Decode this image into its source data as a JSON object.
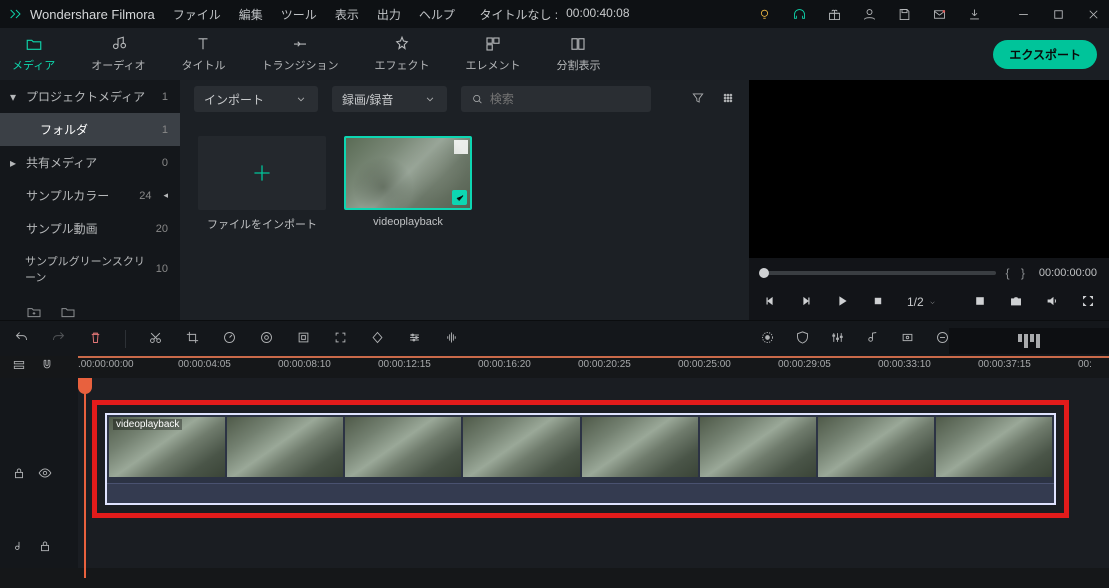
{
  "titlebar": {
    "brand": "Wondershare Filmora",
    "menu": [
      "ファイル",
      "編集",
      "ツール",
      "表示",
      "出力",
      "ヘルプ"
    ],
    "project_title": "タイトルなし :",
    "project_time": "00:00:40:08"
  },
  "tabs": [
    {
      "icon": "folder",
      "label": "メディア",
      "active": true
    },
    {
      "icon": "music",
      "label": "オーディオ",
      "active": false
    },
    {
      "icon": "text",
      "label": "タイトル",
      "active": false
    },
    {
      "icon": "transition",
      "label": "トランジション",
      "active": false
    },
    {
      "icon": "sparkle",
      "label": "エフェクト",
      "active": false
    },
    {
      "icon": "elements",
      "label": "エレメント",
      "active": false
    },
    {
      "icon": "split",
      "label": "分割表示",
      "active": false
    }
  ],
  "export_label": "エクスポート",
  "sidebar": {
    "items": [
      {
        "arrow": "▾",
        "label": "プロジェクトメディア",
        "count": "1",
        "sel": false
      },
      {
        "arrow": "",
        "label": "フォルダ",
        "count": "1",
        "sel": true
      },
      {
        "arrow": "▸",
        "label": "共有メディア",
        "count": "0",
        "sel": false
      },
      {
        "arrow": "",
        "label": "サンプルカラー",
        "count": "24",
        "chev": true,
        "sel": false
      },
      {
        "arrow": "",
        "label": "サンプル動画",
        "count": "20",
        "sel": false
      },
      {
        "arrow": "",
        "label": "サンプルグリーンスクリーン",
        "count": "10",
        "sel": false
      }
    ]
  },
  "mediatool": {
    "import": "インポート",
    "record": "録画/録音",
    "search_placeholder": "検索"
  },
  "cards": {
    "import_label": "ファイルをインポート",
    "clip_label": "videoplayback"
  },
  "preview": {
    "braces": "{    }",
    "timecode": "00:00:00:00",
    "speed": "1/2"
  },
  "ruler": {
    "ticks": [
      {
        "pos": 0,
        "label": ".00:00:00:00"
      },
      {
        "pos": 100,
        "label": "00:00:04:05"
      },
      {
        "pos": 200,
        "label": "00:00:08:10"
      },
      {
        "pos": 300,
        "label": "00:00:12:15"
      },
      {
        "pos": 400,
        "label": "00:00:16:20"
      },
      {
        "pos": 500,
        "label": "00:00:20:25"
      },
      {
        "pos": 600,
        "label": "00:00:25:00"
      },
      {
        "pos": 700,
        "label": "00:00:29:05"
      },
      {
        "pos": 800,
        "label": "00:00:33:10"
      },
      {
        "pos": 900,
        "label": "00:00:37:15"
      },
      {
        "pos": 1000,
        "label": "00:"
      }
    ]
  },
  "clip_label": "videoplayback"
}
